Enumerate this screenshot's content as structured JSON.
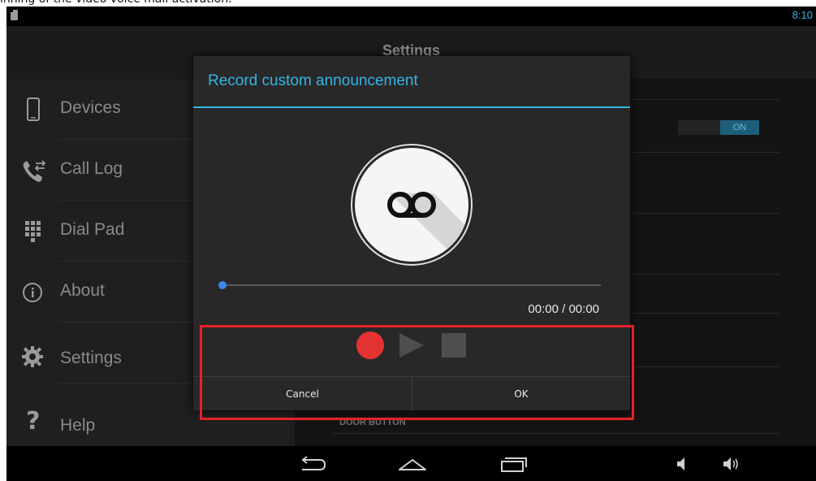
{
  "caption": "inning of the video voice mail activation.",
  "status_bar": {
    "time": "8:10"
  },
  "app_bar": {
    "title": "Settings"
  },
  "sidebar": {
    "items": [
      {
        "label": "Devices",
        "icon": "phone-icon"
      },
      {
        "label": "Call Log",
        "icon": "call-log-icon"
      },
      {
        "label": "Dial Pad",
        "icon": "dialpad-icon"
      },
      {
        "label": "About",
        "icon": "info-icon"
      },
      {
        "label": "Settings",
        "icon": "gear-icon"
      },
      {
        "label": "Help",
        "icon": "question-icon"
      }
    ]
  },
  "settings_panel": {
    "toggle_label": "ON",
    "door_button_label": "DOOR BUTTON"
  },
  "dialog": {
    "title": "Record custom announcement",
    "icon": "voicemail-icon",
    "playback": {
      "time_readout": "00:00 / 00:00",
      "progress": 0
    },
    "controls": {
      "record": "record-icon",
      "play": "play-icon",
      "stop": "stop-icon"
    },
    "cancel_label": "Cancel",
    "ok_label": "OK"
  },
  "nav_bar": {
    "buttons": [
      "back-icon",
      "home-icon",
      "recent-apps-icon",
      "volume-down-icon",
      "volume-up-icon"
    ]
  },
  "colors": {
    "accent": "#33b5e5",
    "record": "#e53232",
    "highlight_box": "#e8202a",
    "seek_thumb": "#3d88e8"
  }
}
